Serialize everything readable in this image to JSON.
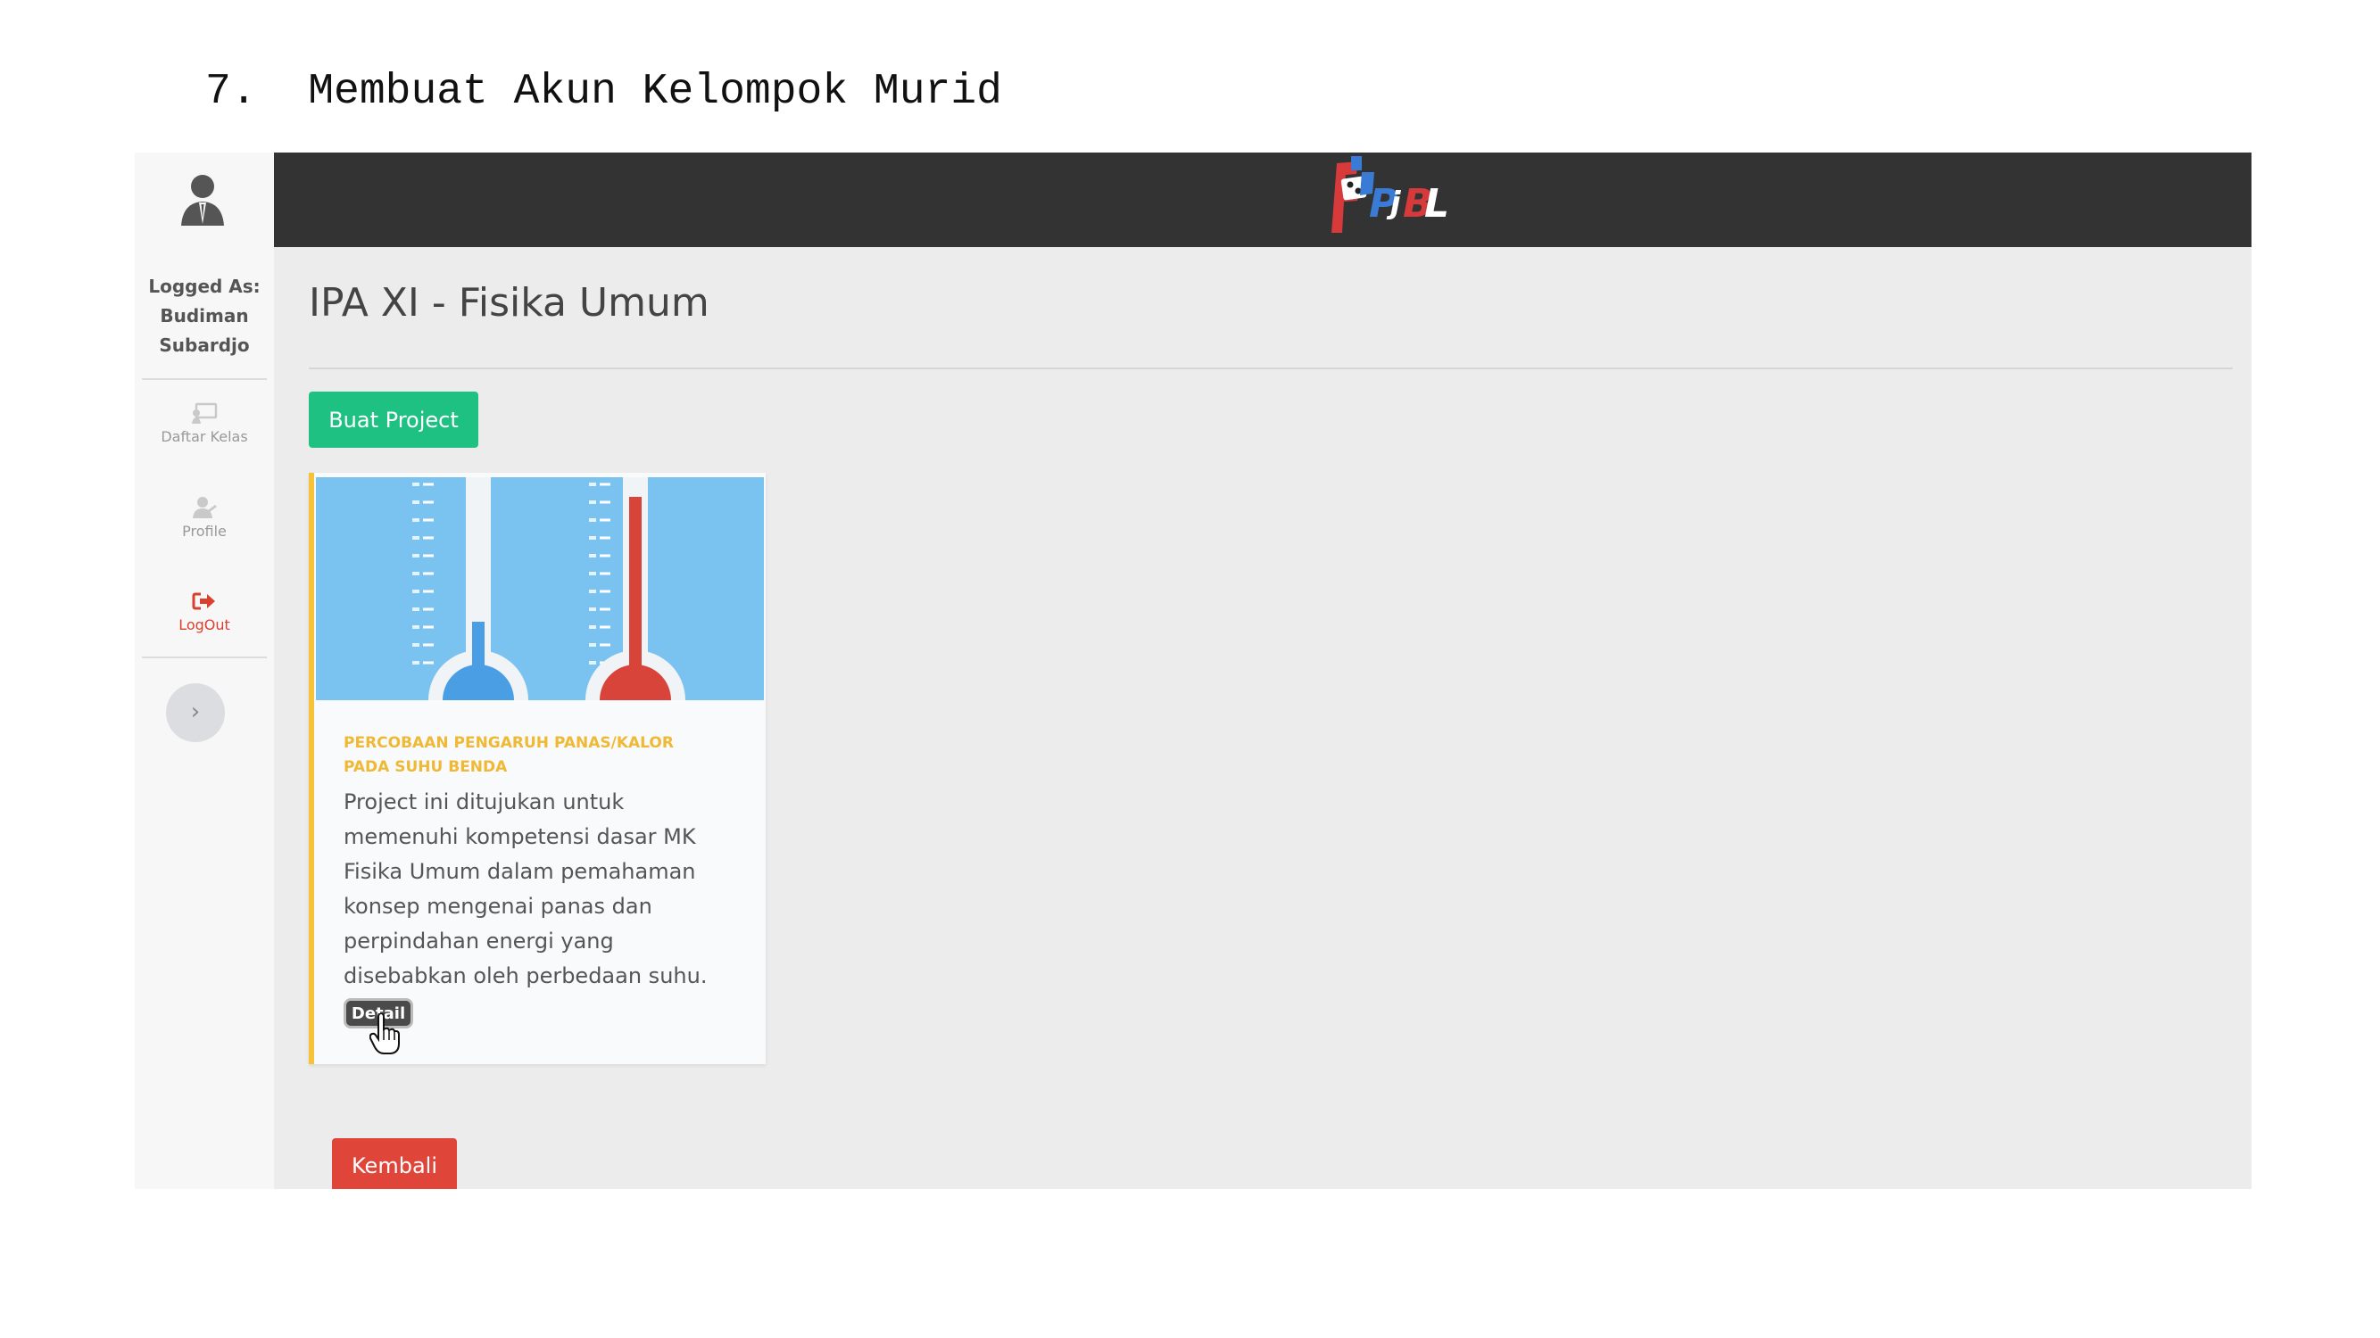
{
  "document": {
    "heading": "7.  Membuat Akun Kelompok Murid"
  },
  "sidebar": {
    "logged_as_label": "Logged As:",
    "user_first": "Budiman",
    "user_last": "Subardjo",
    "items": [
      {
        "label": "Daftar Kelas",
        "icon": "chalkboard-icon"
      },
      {
        "label": "Profile",
        "icon": "user-icon"
      },
      {
        "label": "LogOut",
        "icon": "logout-icon",
        "color": "#d9412f"
      }
    ],
    "toggle_icon": "chevron-right-icon"
  },
  "header": {
    "logo_text": "PjBL"
  },
  "main": {
    "title": "IPA XI - Fisika Umum",
    "create_button": "Buat Project",
    "back_button": "Kembali"
  },
  "project_card": {
    "image": "thermometers-illustration",
    "tag": "PERCOBAAN PENGARUH PANAS/KALOR PADA SUHU BENDA",
    "description": "Project ini ditujukan untuk memenuhi kompetensi dasar MK Fisika Umum dalam pemahaman konsep mengenai panas dan perpindahan energi yang disebabkan oleh perbedaan suhu.",
    "detail_button": "Detail",
    "accent_color": "#f5c23a"
  },
  "colors": {
    "topbar": "#333333",
    "primary": "#1fc183",
    "danger": "#e0453a",
    "background": "#ececec"
  }
}
